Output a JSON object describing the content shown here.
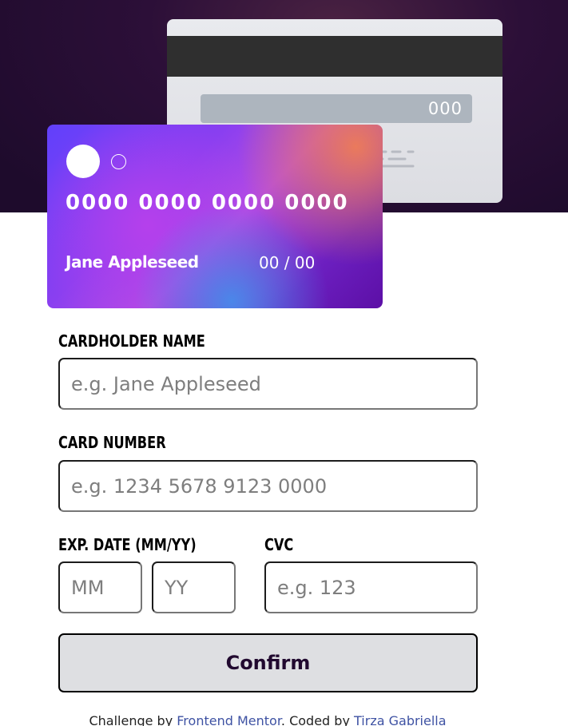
{
  "card_preview": {
    "back": {
      "cvc": "000"
    },
    "front": {
      "number": "0000 0000 0000 0000",
      "holder": "Jane Appleseed",
      "expiry": "00 / 00"
    }
  },
  "form": {
    "cardholder": {
      "label": "CARDHOLDER NAME",
      "placeholder": "e.g. Jane Appleseed"
    },
    "card_number": {
      "label": "CARD NUMBER",
      "placeholder": "e.g. 1234 5678 9123 0000"
    },
    "expiry": {
      "label": "EXP. DATE (MM/YY)",
      "month_placeholder": "MM",
      "year_placeholder": "YY"
    },
    "cvc": {
      "label": "CVC",
      "placeholder": "e.g. 123"
    },
    "submit_label": "Confirm"
  },
  "footer": {
    "prefix": "Challenge by ",
    "link1": "Frontend Mentor",
    "middle": ". Coded by ",
    "link2": "Tirza Gabriella"
  },
  "colors": {
    "hero_bg": "#2c0f38",
    "accent_dark": "#21092f",
    "button_bg": "#dedfe2",
    "link": "#3e52a3"
  }
}
